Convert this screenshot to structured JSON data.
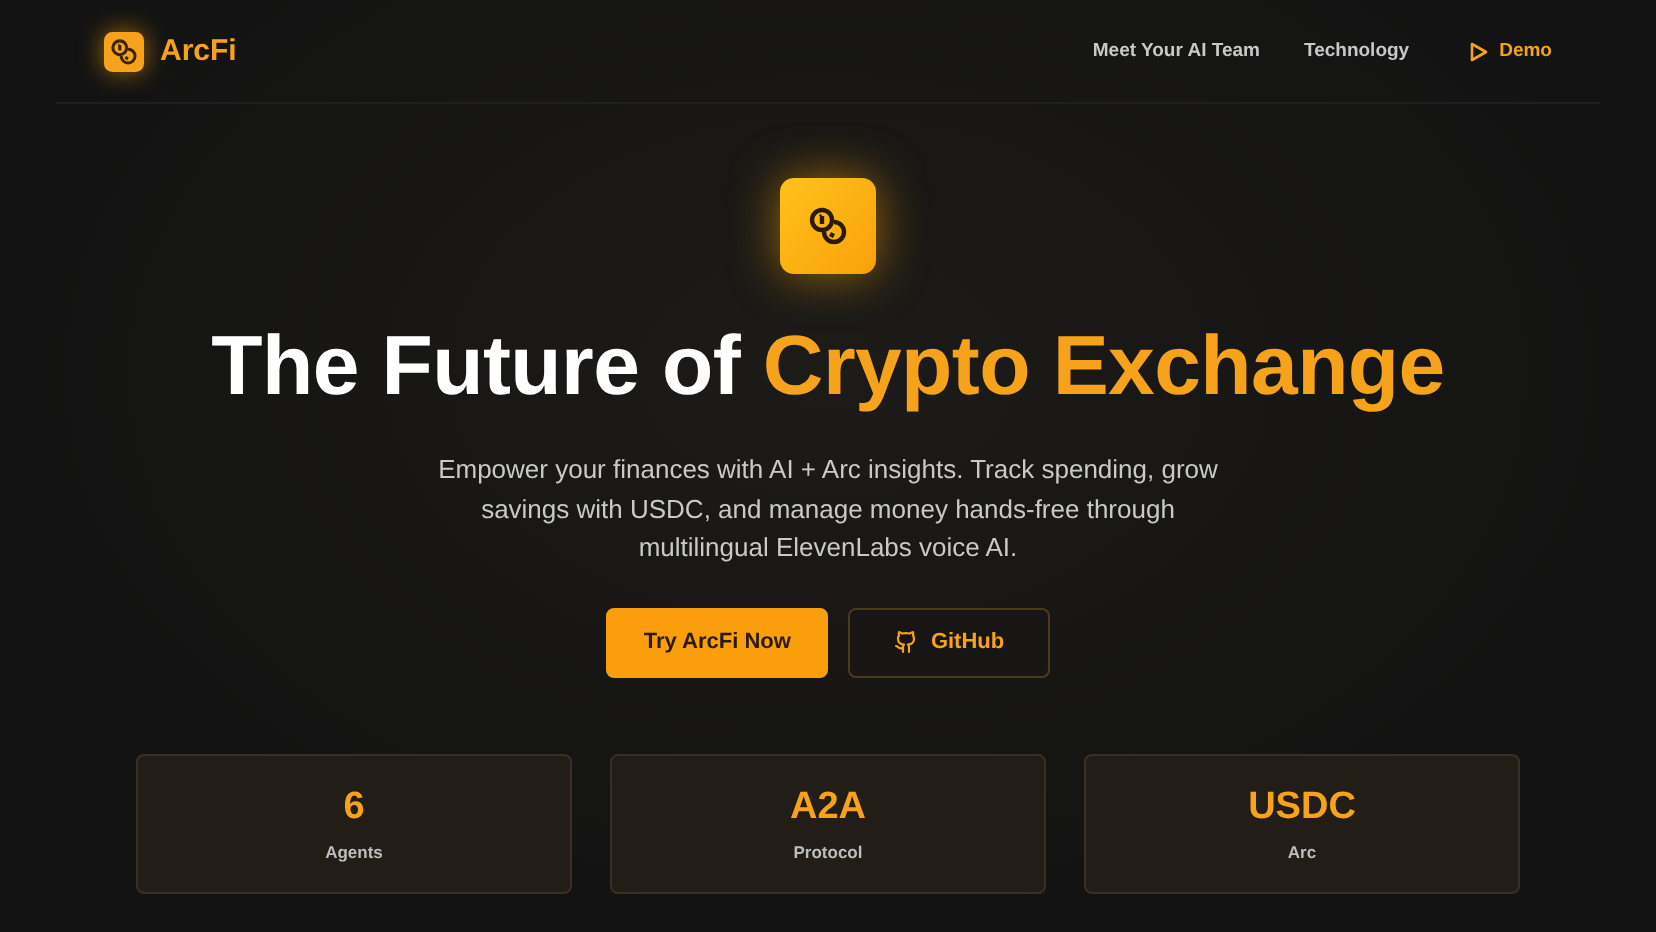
{
  "header": {
    "brand": "ArcFi",
    "nav": [
      {
        "label": "Meet Your AI Team",
        "kind": "link"
      },
      {
        "label": "Technology",
        "kind": "link"
      },
      {
        "label": "Demo",
        "kind": "demo"
      }
    ]
  },
  "hero": {
    "title": "The Future of ",
    "title_highlight": "Crypto Exchange",
    "description": "Empower your finances with AI + Arc insights. Track spending, grow savings with USDC, and manage money hands-free through multilingual ElevenLabs voice AI.",
    "buttons": [
      {
        "label": "Try ArcFi Now",
        "kind": "primary"
      },
      {
        "label": "GitHub",
        "kind": "github"
      }
    ]
  },
  "stats": [
    {
      "value": "6",
      "label": "Agents"
    },
    {
      "value": "A2A",
      "label": "Protocol"
    },
    {
      "value": "USDC",
      "label": "Arc"
    }
  ]
}
